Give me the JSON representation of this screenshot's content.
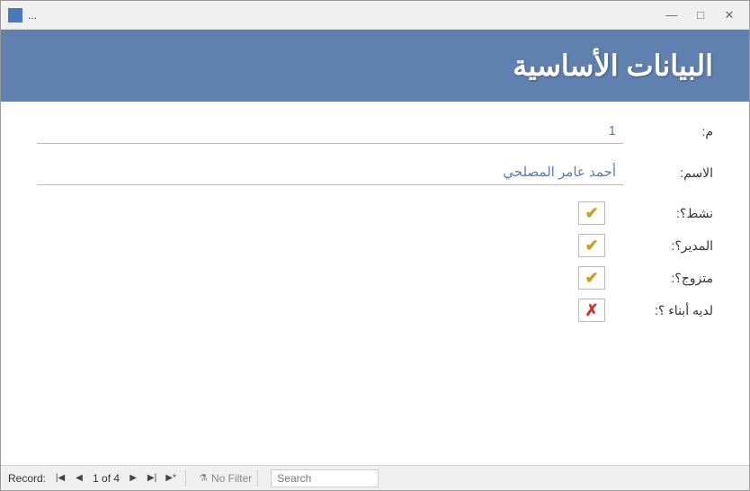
{
  "titlebar": {
    "title": "...",
    "minimize": "—",
    "maximize": "□",
    "close": "✕"
  },
  "header": {
    "title": "البيانات الأساسية"
  },
  "form": {
    "fields": [
      {
        "label": "م:",
        "value": "1",
        "type": "number"
      },
      {
        "label": "الاسم:",
        "value": "أحمد عامر المصلحي",
        "type": "text"
      }
    ],
    "checkboxes": [
      {
        "label": "نشط؟:",
        "checked": true
      },
      {
        "label": "المدير؟:",
        "checked": true
      },
      {
        "label": "متزوج؟:",
        "checked": true
      },
      {
        "label": "لديه أبناء ؟:",
        "checked": false
      }
    ]
  },
  "statusbar": {
    "record_label": "Record:",
    "record_current": "1 of 4",
    "no_filter": "No Filter",
    "search_placeholder": "Search"
  }
}
